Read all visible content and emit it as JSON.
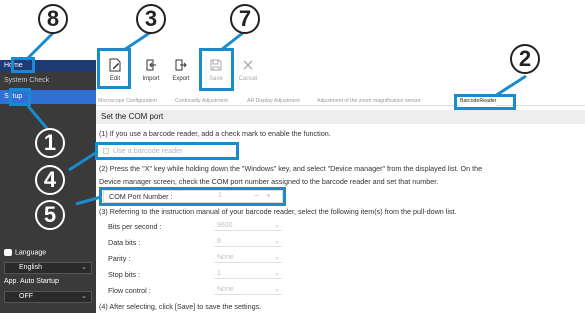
{
  "sidebar": {
    "home": "Home",
    "system_check": "System Check",
    "setup": "Setup",
    "language_label": "Language",
    "language_value": "English",
    "auto_startup_label": "App. Auto Startup",
    "auto_startup_value": "OFF"
  },
  "toolbar": {
    "edit": "Edit",
    "import": "Import",
    "export": "Export",
    "save": "Save",
    "cancel": "Cancel"
  },
  "tabs": [
    "Microscope Configuration",
    "Confocality Adjustment",
    "AR Display Adjustment",
    "Adjustment of the zoom magnification sensor",
    "BarcodeReader"
  ],
  "content": {
    "section_title": "Set the COM port",
    "step1": "(1) If you use a barcode reader, add a check mark to enable the function.",
    "use_barcode": "Use a barcode reader",
    "step2_line1": "(2) Press the \"X\" key while holding down the \"Windows\" key, and select \"Device manager\" from the displayed list. On the",
    "step2_line2": "Device manager screen, check the COM port number assigned to the barcode reader and set that number.",
    "com_port_label": "COM Port Number :",
    "com_port_value": "1",
    "step3": "(3) Referring to the instruction manual of your barcode reader, select the following item(s) from the pull-down list.",
    "fields": [
      {
        "label": "Bits per second :",
        "value": "9600"
      },
      {
        "label": "Data bits :",
        "value": "8"
      },
      {
        "label": "Parity :",
        "value": "None"
      },
      {
        "label": "Stop bits :",
        "value": "1"
      },
      {
        "label": "Flow control :",
        "value": "None"
      }
    ],
    "step4": "(4) After selecting, click [Save] to save the settings."
  },
  "callouts": [
    "1",
    "2",
    "3",
    "4",
    "5",
    "7",
    "8"
  ],
  "colors": {
    "callout": "#1a8bd1",
    "sidebar_bg": "#3a3a3a",
    "setup_active": "#2f6fd6",
    "home_active": "#1f3b74"
  }
}
